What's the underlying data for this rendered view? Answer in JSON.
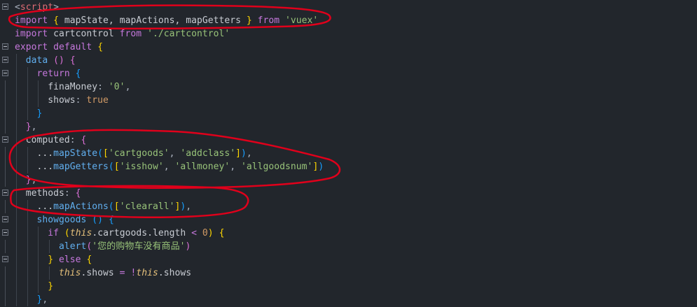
{
  "editor": {
    "theme_colors": {
      "background": "#22262c",
      "keyword": "#c678dd",
      "string": "#98c379",
      "function": "#61afef",
      "annotation": "#e0001b"
    },
    "lines": [
      {
        "fold": "collapse",
        "guides": 0,
        "tokens": [
          {
            "t": "<",
            "c": "c-punc"
          },
          {
            "t": "script",
            "c": "c-tag"
          },
          {
            "t": ">",
            "c": "c-punc"
          }
        ]
      },
      {
        "fold": "none",
        "guides": 0,
        "tokens": [
          {
            "t": "import",
            "c": "c-kw"
          },
          {
            "t": " ",
            "c": "c-plain"
          },
          {
            "t": "{",
            "c": "c-brk-y"
          },
          {
            "t": " mapState, mapActions, mapGetters ",
            "c": "c-plain"
          },
          {
            "t": "}",
            "c": "c-brk-y"
          },
          {
            "t": " ",
            "c": "c-plain"
          },
          {
            "t": "from",
            "c": "c-kw"
          },
          {
            "t": " ",
            "c": "c-plain"
          },
          {
            "t": "'vuex'",
            "c": "c-str"
          }
        ]
      },
      {
        "fold": "none",
        "guides": 0,
        "tokens": [
          {
            "t": "import",
            "c": "c-kw"
          },
          {
            "t": " cartcontrol ",
            "c": "c-plain"
          },
          {
            "t": "from",
            "c": "c-kw"
          },
          {
            "t": " ",
            "c": "c-plain"
          },
          {
            "t": "'./cartcontrol'",
            "c": "c-str"
          }
        ]
      },
      {
        "fold": "collapse",
        "guides": 0,
        "tokens": [
          {
            "t": "export",
            "c": "c-kw"
          },
          {
            "t": " ",
            "c": "c-plain"
          },
          {
            "t": "default",
            "c": "c-kw"
          },
          {
            "t": " ",
            "c": "c-plain"
          },
          {
            "t": "{",
            "c": "c-brk-y"
          }
        ]
      },
      {
        "fold": "collapse",
        "guides": 1,
        "tokens": [
          {
            "t": "  ",
            "c": "c-plain"
          },
          {
            "t": "data",
            "c": "c-fn"
          },
          {
            "t": " ",
            "c": "c-plain"
          },
          {
            "t": "()",
            "c": "c-brk-p"
          },
          {
            "t": " ",
            "c": "c-plain"
          },
          {
            "t": "{",
            "c": "c-brk-p"
          }
        ]
      },
      {
        "fold": "collapse",
        "guides": 2,
        "tokens": [
          {
            "t": "    ",
            "c": "c-plain"
          },
          {
            "t": "return",
            "c": "c-kw"
          },
          {
            "t": " ",
            "c": "c-plain"
          },
          {
            "t": "{",
            "c": "c-brk-b"
          }
        ]
      },
      {
        "fold": "line",
        "guides": 3,
        "tokens": [
          {
            "t": "      ",
            "c": "c-plain"
          },
          {
            "t": "finaMoney",
            "c": "c-prop"
          },
          {
            "t": ": ",
            "c": "c-punc"
          },
          {
            "t": "'0'",
            "c": "c-str"
          },
          {
            "t": ",",
            "c": "c-punc"
          }
        ]
      },
      {
        "fold": "line",
        "guides": 3,
        "tokens": [
          {
            "t": "      ",
            "c": "c-plain"
          },
          {
            "t": "shows",
            "c": "c-prop"
          },
          {
            "t": ": ",
            "c": "c-punc"
          },
          {
            "t": "true",
            "c": "c-bool"
          }
        ]
      },
      {
        "fold": "line",
        "guides": 2,
        "tokens": [
          {
            "t": "    ",
            "c": "c-plain"
          },
          {
            "t": "}",
            "c": "c-brk-b"
          }
        ]
      },
      {
        "fold": "line",
        "guides": 1,
        "tokens": [
          {
            "t": "  ",
            "c": "c-plain"
          },
          {
            "t": "}",
            "c": "c-brk-p"
          },
          {
            "t": ",",
            "c": "c-punc"
          }
        ]
      },
      {
        "fold": "collapse",
        "guides": 1,
        "tokens": [
          {
            "t": "  ",
            "c": "c-plain"
          },
          {
            "t": "computed",
            "c": "c-prop"
          },
          {
            "t": ": ",
            "c": "c-punc"
          },
          {
            "t": "{",
            "c": "c-brk-p"
          }
        ]
      },
      {
        "fold": "line",
        "guides": 2,
        "tokens": [
          {
            "t": "    ...",
            "c": "c-plain"
          },
          {
            "t": "mapState",
            "c": "c-fn"
          },
          {
            "t": "(",
            "c": "c-brk-b"
          },
          {
            "t": "[",
            "c": "c-brk-y"
          },
          {
            "t": "'cartgoods'",
            "c": "c-str"
          },
          {
            "t": ", ",
            "c": "c-punc"
          },
          {
            "t": "'addclass'",
            "c": "c-str"
          },
          {
            "t": "]",
            "c": "c-brk-y"
          },
          {
            "t": ")",
            "c": "c-brk-b"
          },
          {
            "t": ",",
            "c": "c-punc"
          }
        ]
      },
      {
        "fold": "line",
        "guides": 2,
        "tokens": [
          {
            "t": "    ...",
            "c": "c-plain"
          },
          {
            "t": "mapGetters",
            "c": "c-fn"
          },
          {
            "t": "(",
            "c": "c-brk-b"
          },
          {
            "t": "[",
            "c": "c-brk-y"
          },
          {
            "t": "'isshow'",
            "c": "c-str"
          },
          {
            "t": ", ",
            "c": "c-punc"
          },
          {
            "t": "'allmoney'",
            "c": "c-str"
          },
          {
            "t": ", ",
            "c": "c-punc"
          },
          {
            "t": "'allgoodsnum'",
            "c": "c-str"
          },
          {
            "t": "]",
            "c": "c-brk-y"
          },
          {
            "t": ")",
            "c": "c-brk-b"
          }
        ]
      },
      {
        "fold": "line",
        "guides": 1,
        "tokens": [
          {
            "t": "  ",
            "c": "c-plain"
          },
          {
            "t": "}",
            "c": "c-brk-p"
          },
          {
            "t": ",",
            "c": "c-punc"
          }
        ]
      },
      {
        "fold": "collapse",
        "guides": 1,
        "tokens": [
          {
            "t": "  ",
            "c": "c-plain"
          },
          {
            "t": "methods",
            "c": "c-prop"
          },
          {
            "t": ": ",
            "c": "c-punc"
          },
          {
            "t": "{",
            "c": "c-brk-p"
          }
        ]
      },
      {
        "fold": "line",
        "guides": 2,
        "tokens": [
          {
            "t": "    ...",
            "c": "c-plain"
          },
          {
            "t": "mapActions",
            "c": "c-fn"
          },
          {
            "t": "(",
            "c": "c-brk-b"
          },
          {
            "t": "[",
            "c": "c-brk-y"
          },
          {
            "t": "'clearall'",
            "c": "c-str"
          },
          {
            "t": "]",
            "c": "c-brk-y"
          },
          {
            "t": ")",
            "c": "c-brk-b"
          },
          {
            "t": ",",
            "c": "c-punc"
          }
        ]
      },
      {
        "fold": "collapse",
        "guides": 2,
        "tokens": [
          {
            "t": "    ",
            "c": "c-plain"
          },
          {
            "t": "showgoods",
            "c": "c-fn"
          },
          {
            "t": " ",
            "c": "c-plain"
          },
          {
            "t": "()",
            "c": "c-brk-b"
          },
          {
            "t": " ",
            "c": "c-plain"
          },
          {
            "t": "{",
            "c": "c-brk-b"
          }
        ]
      },
      {
        "fold": "collapse",
        "guides": 3,
        "tokens": [
          {
            "t": "      ",
            "c": "c-plain"
          },
          {
            "t": "if",
            "c": "c-kw"
          },
          {
            "t": " ",
            "c": "c-plain"
          },
          {
            "t": "(",
            "c": "c-brk-y"
          },
          {
            "t": "this",
            "c": "c-this"
          },
          {
            "t": ".cartgoods.length ",
            "c": "c-plain"
          },
          {
            "t": "<",
            "c": "c-kw"
          },
          {
            "t": " ",
            "c": "c-plain"
          },
          {
            "t": "0",
            "c": "c-num"
          },
          {
            "t": ")",
            "c": "c-brk-y"
          },
          {
            "t": " ",
            "c": "c-plain"
          },
          {
            "t": "{",
            "c": "c-brk-y"
          }
        ]
      },
      {
        "fold": "line",
        "guides": 4,
        "tokens": [
          {
            "t": "        ",
            "c": "c-plain"
          },
          {
            "t": "alert",
            "c": "c-fn"
          },
          {
            "t": "(",
            "c": "c-brk-p"
          },
          {
            "t": "'您的购物车没有商品'",
            "c": "c-str"
          },
          {
            "t": ")",
            "c": "c-brk-p"
          }
        ]
      },
      {
        "fold": "collapse",
        "guides": 3,
        "tokens": [
          {
            "t": "      ",
            "c": "c-plain"
          },
          {
            "t": "}",
            "c": "c-brk-y"
          },
          {
            "t": " ",
            "c": "c-plain"
          },
          {
            "t": "else",
            "c": "c-kw"
          },
          {
            "t": " ",
            "c": "c-plain"
          },
          {
            "t": "{",
            "c": "c-brk-y"
          }
        ]
      },
      {
        "fold": "line",
        "guides": 4,
        "tokens": [
          {
            "t": "        ",
            "c": "c-plain"
          },
          {
            "t": "this",
            "c": "c-this"
          },
          {
            "t": ".shows ",
            "c": "c-plain"
          },
          {
            "t": "=",
            "c": "c-kw"
          },
          {
            "t": " ",
            "c": "c-plain"
          },
          {
            "t": "!",
            "c": "c-kw"
          },
          {
            "t": "this",
            "c": "c-this"
          },
          {
            "t": ".shows",
            "c": "c-plain"
          }
        ]
      },
      {
        "fold": "line",
        "guides": 3,
        "tokens": [
          {
            "t": "      ",
            "c": "c-plain"
          },
          {
            "t": "}",
            "c": "c-brk-y"
          }
        ]
      },
      {
        "fold": "line",
        "guides": 2,
        "tokens": [
          {
            "t": "    ",
            "c": "c-plain"
          },
          {
            "t": "}",
            "c": "c-brk-b"
          },
          {
            "t": ",",
            "c": "c-punc"
          }
        ]
      }
    ]
  }
}
